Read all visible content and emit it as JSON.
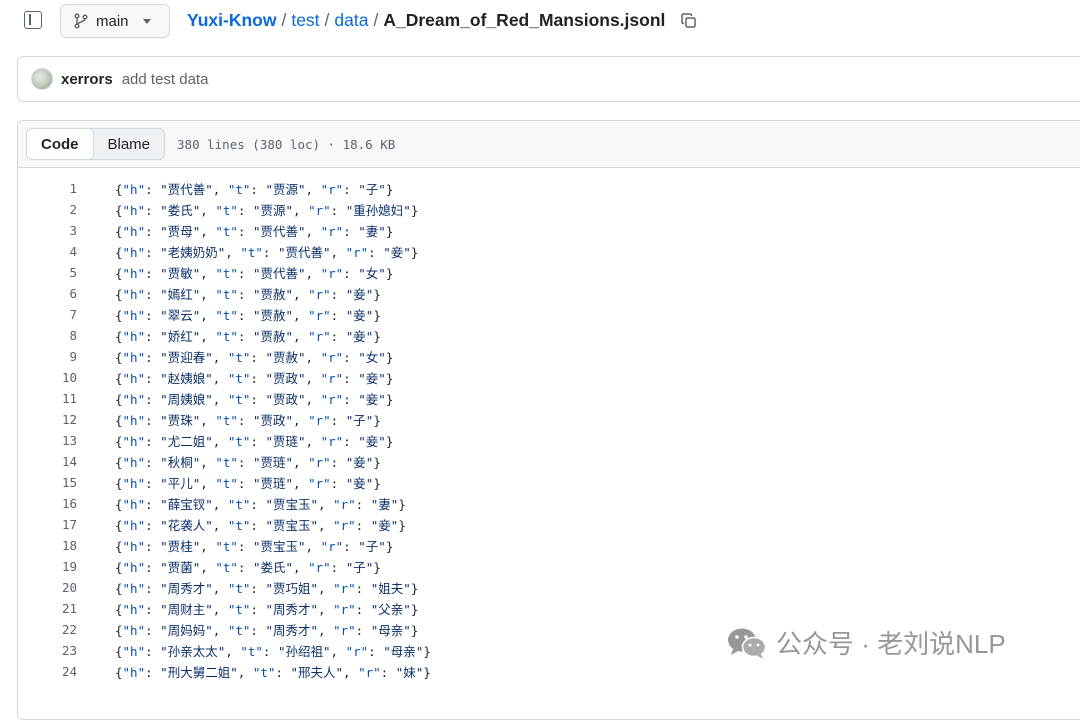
{
  "topbar": {
    "branch": "main",
    "breadcrumb": {
      "repo": "Yuxi-Know",
      "sep": "/",
      "dirs": [
        "test",
        "data"
      ],
      "file": "A_Dream_of_Red_Mansions.jsonl"
    }
  },
  "commit": {
    "author": "xerrors",
    "message": "add test data"
  },
  "file": {
    "tabs": [
      {
        "label": "Code",
        "active": true
      },
      {
        "label": "Blame",
        "active": false
      }
    ],
    "info": "380 lines (380 loc) · 18.6 KB",
    "lines": [
      {
        "num": "1",
        "h": "贾代善",
        "t": "贾源",
        "r": "子"
      },
      {
        "num": "2",
        "h": "娄氏",
        "t": "贾源",
        "r": "重孙媳妇"
      },
      {
        "num": "3",
        "h": "贾母",
        "t": "贾代善",
        "r": "妻"
      },
      {
        "num": "4",
        "h": "老姨奶奶",
        "t": "贾代善",
        "r": "妾"
      },
      {
        "num": "5",
        "h": "贾敏",
        "t": "贾代善",
        "r": "女"
      },
      {
        "num": "6",
        "h": "嫣红",
        "t": "贾赦",
        "r": "妾"
      },
      {
        "num": "7",
        "h": "翠云",
        "t": "贾赦",
        "r": "妾"
      },
      {
        "num": "8",
        "h": "娇红",
        "t": "贾赦",
        "r": "妾"
      },
      {
        "num": "9",
        "h": "贾迎春",
        "t": "贾赦",
        "r": "女"
      },
      {
        "num": "10",
        "h": "赵姨娘",
        "t": "贾政",
        "r": "妾"
      },
      {
        "num": "11",
        "h": "周姨娘",
        "t": "贾政",
        "r": "妾"
      },
      {
        "num": "12",
        "h": "贾珠",
        "t": "贾政",
        "r": "子"
      },
      {
        "num": "13",
        "h": "尤二姐",
        "t": "贾琏",
        "r": "妾"
      },
      {
        "num": "14",
        "h": "秋桐",
        "t": "贾琏",
        "r": "妾"
      },
      {
        "num": "15",
        "h": "平儿",
        "t": "贾琏",
        "r": "妾"
      },
      {
        "num": "16",
        "h": "薛宝钗",
        "t": "贾宝玉",
        "r": "妻"
      },
      {
        "num": "17",
        "h": "花袭人",
        "t": "贾宝玉",
        "r": "妾"
      },
      {
        "num": "18",
        "h": "贾桂",
        "t": "贾宝玉",
        "r": "子"
      },
      {
        "num": "19",
        "h": "贾菌",
        "t": "娄氏",
        "r": "子"
      },
      {
        "num": "20",
        "h": "周秀才",
        "t": "贾巧姐",
        "r": "姐夫"
      },
      {
        "num": "21",
        "h": "周财主",
        "t": "周秀才",
        "r": "父亲"
      },
      {
        "num": "22",
        "h": "周妈妈",
        "t": "周秀才",
        "r": "母亲"
      },
      {
        "num": "23",
        "h": "孙亲太太",
        "t": "孙绍祖",
        "r": "母亲"
      },
      {
        "num": "24",
        "h": "刑大舅二姐",
        "t": "邢夫人",
        "r": "妹"
      }
    ]
  },
  "watermark": {
    "text": "公众号 · 老刘说NLP"
  },
  "colors": {
    "link": "#0969da",
    "json_key": "#0550ae",
    "json_string": "#0a3069",
    "muted": "#59636e",
    "border": "#d1d9e0"
  }
}
